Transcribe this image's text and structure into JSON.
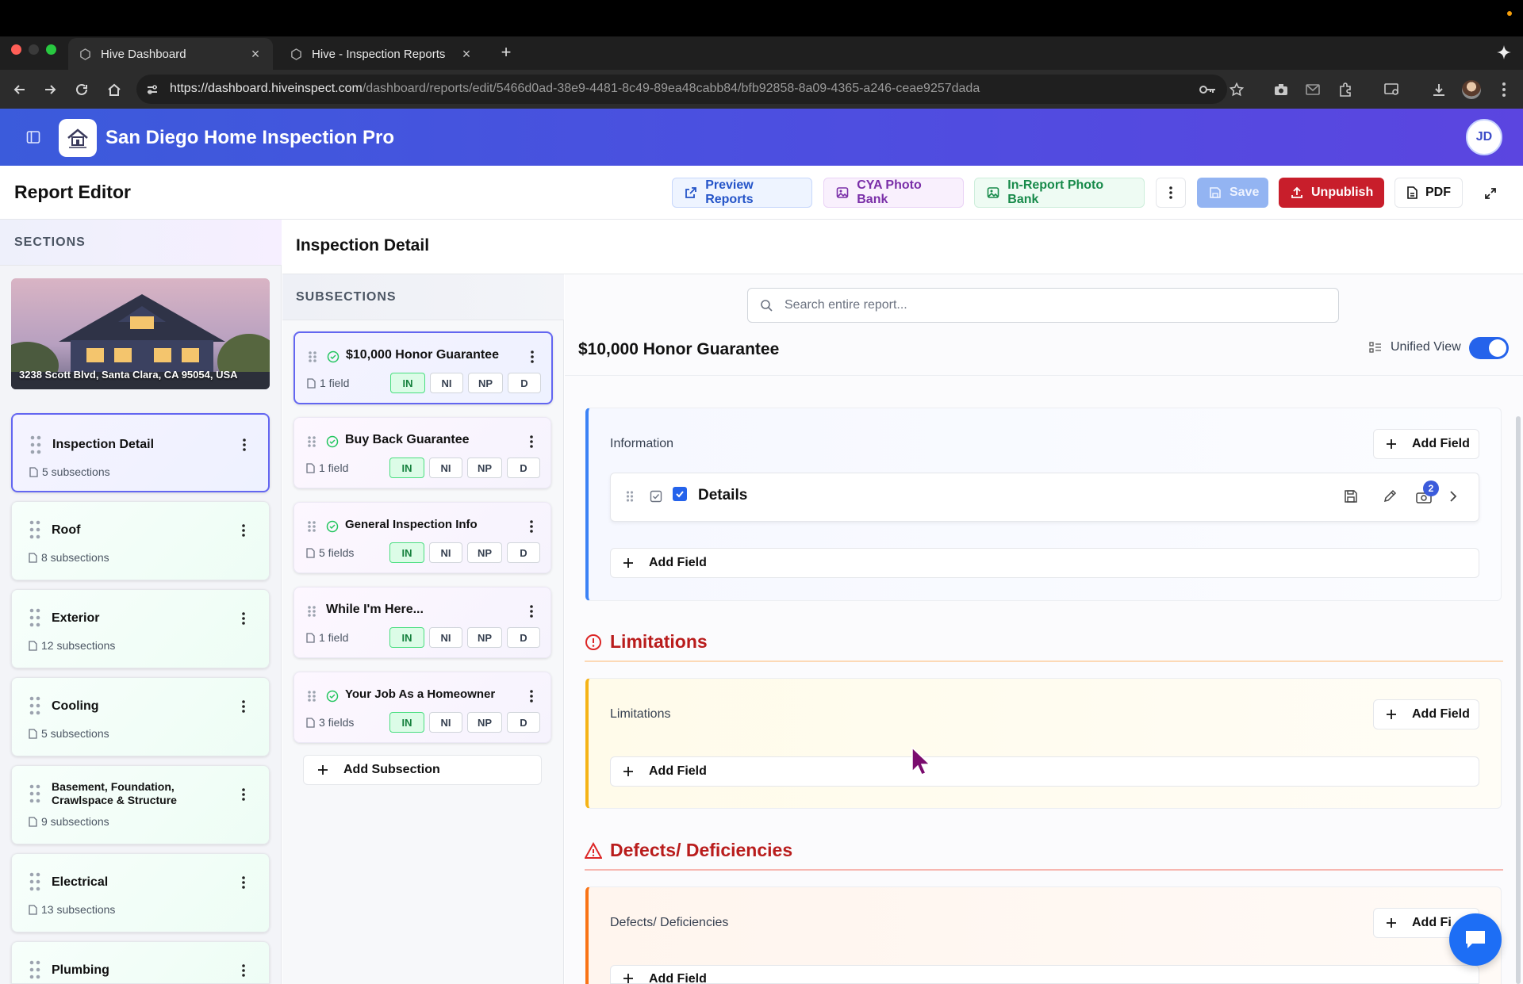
{
  "browser": {
    "tabs": [
      {
        "title": "Hive Dashboard",
        "active": true
      },
      {
        "title": "Hive - Inspection Reports",
        "active": false
      }
    ],
    "url_host": "https://dashboard.hiveinspect.com",
    "url_path": "/dashboard/reports/edit/5466d0ad-38e9-4481-8c49-89ea48cabb84/bfb92858-8a09-4365-a246-ceae9257dada"
  },
  "app": {
    "company_name": "San Diego Home Inspection Pro",
    "user_initials": "JD"
  },
  "editor": {
    "title": "Report Editor",
    "buttons": {
      "preview": "Preview Reports",
      "cya": "CYA Photo Bank",
      "inreport": "In-Report Photo Bank",
      "save": "Save",
      "unpublish": "Unpublish",
      "pdf": "PDF"
    }
  },
  "sections": {
    "heading": "SECTIONS",
    "property_address": "3238 Scott Blvd, Santa Clara, CA 95054, USA",
    "items": [
      {
        "name": "Inspection Detail",
        "count": "5 subsections",
        "active": true
      },
      {
        "name": "Roof",
        "count": "8 subsections"
      },
      {
        "name": "Exterior",
        "count": "12 subsections"
      },
      {
        "name": "Cooling",
        "count": "5 subsections"
      },
      {
        "name": "Basement, Foundation, Crawlspace & Structure",
        "name_line1": "Basement, Foundation,",
        "name_line2": "Crawlspace & Structure",
        "count": "9 subsections"
      },
      {
        "name": "Electrical",
        "count": "13 subsections"
      },
      {
        "name": "Plumbing",
        "count": ""
      }
    ]
  },
  "middle": {
    "title": "Inspection Detail",
    "subsections_heading": "SUBSECTIONS",
    "status_labels": [
      "IN",
      "NI",
      "NP",
      "D"
    ],
    "subsections": [
      {
        "name": "$10,000 Honor Guarantee",
        "fields": "1 field",
        "active": true
      },
      {
        "name": "Buy Back Guarantee",
        "fields": "1 field"
      },
      {
        "name": "General Inspection Info",
        "fields": "5 fields"
      },
      {
        "name": "While I'm Here...",
        "fields": "1 field"
      },
      {
        "name": "Your Job As a Homeowner",
        "fields": "3 fields"
      }
    ],
    "add_subsection": "Add Subsection"
  },
  "right": {
    "search_placeholder": "Search entire report...",
    "title": "$10,000 Honor Guarantee",
    "unified_view_label": "Unified View",
    "unified_view_on": true,
    "information_label": "Information",
    "add_field": "Add Field",
    "add_field_truncated": "Add Fi",
    "detail_name": "Details",
    "detail_badge": "2",
    "limitations_heading": "Limitations",
    "limitations_label": "Limitations",
    "defects_heading": "Defects/ Deficiencies",
    "defects_label": "Defects/ Deficiencies"
  },
  "colors": {
    "brand_blue": "#3b5bdb",
    "unpublish_red": "#c81e2b",
    "status_green": "#15803d",
    "limitations_red": "#b91c1c"
  }
}
